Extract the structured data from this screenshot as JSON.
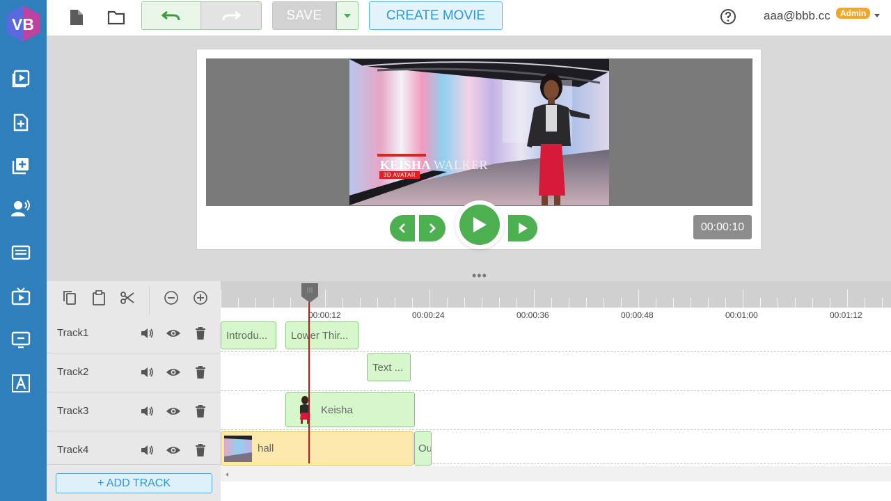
{
  "app": {
    "logo_text": "VB"
  },
  "sidebar": {
    "items": [
      {
        "icon": "play-square-icon"
      },
      {
        "icon": "add-file-icon"
      },
      {
        "icon": "add-box-icon"
      },
      {
        "icon": "voice-user-icon"
      },
      {
        "icon": "subtitles-icon"
      },
      {
        "icon": "tv-play-icon"
      },
      {
        "icon": "monitor-icon"
      },
      {
        "icon": "text-a-icon"
      }
    ]
  },
  "toolbar": {
    "save_label": "SAVE",
    "create_movie_label": "CREATE MOVIE",
    "help_icon": "help-circle-icon"
  },
  "user": {
    "email": "aaa@bbb.cc",
    "badge": "Admin"
  },
  "preview": {
    "lower_third_first": "KEISHA",
    "lower_third_last": "WALKER",
    "lower_third_sub": "3D AVATAR",
    "current_time": "00:00:10"
  },
  "timeline": {
    "ticks": [
      "00:00:12",
      "00:00:24",
      "00:00:36",
      "00:00:48",
      "00:01:00",
      "00:01:12"
    ],
    "tracks": [
      {
        "name": "Track1",
        "clips": [
          {
            "label": "Introdu...",
            "type": "text"
          },
          {
            "label": "Lower Thir...",
            "type": "text"
          }
        ]
      },
      {
        "name": "Track2",
        "clips": [
          {
            "label": "Text ...",
            "type": "text"
          }
        ]
      },
      {
        "name": "Track3",
        "clips": [
          {
            "label": "Keisha",
            "type": "avatar"
          }
        ]
      },
      {
        "name": "Track4",
        "clips": [
          {
            "label": "hall",
            "type": "video"
          },
          {
            "label": "Ou",
            "type": "text"
          }
        ]
      }
    ],
    "add_track_label": "+ ADD TRACK"
  },
  "colors": {
    "sidebar": "#2f7fbd",
    "accent_green": "#4caf50",
    "accent_blue": "#2a9ad8",
    "clip_green": "#d6f7cc",
    "clip_audio": "#fde8ad",
    "playhead": "#b71c1c",
    "badge": "#f5a623"
  }
}
